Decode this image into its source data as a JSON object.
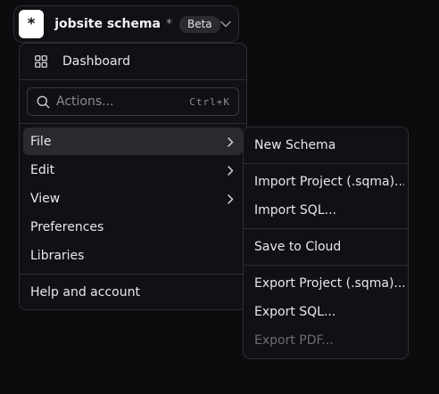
{
  "header": {
    "logo_glyph": "*",
    "project_name": "jobsite schema",
    "unsaved_marker": "*",
    "badge": "Beta"
  },
  "menu": {
    "dashboard_label": "Dashboard",
    "search": {
      "placeholder": "Actions...",
      "shortcut": "Ctrl+K"
    },
    "items": [
      {
        "label": "File",
        "has_submenu": true,
        "active": true
      },
      {
        "label": "Edit",
        "has_submenu": true
      },
      {
        "label": "View",
        "has_submenu": true
      },
      {
        "label": "Preferences"
      },
      {
        "label": "Libraries"
      }
    ],
    "help_label": "Help and account"
  },
  "file_submenu": {
    "items": [
      {
        "label": "New Schema"
      },
      {
        "label": "Import Project (.sqma)..."
      },
      {
        "label": "Import SQL..."
      },
      {
        "label": "Save to Cloud"
      },
      {
        "label": "Export Project (.sqma)..."
      },
      {
        "label": "Export SQL..."
      },
      {
        "label": "Export PDF...",
        "disabled": true
      }
    ]
  },
  "colors": {
    "background": "#0c0b0e",
    "panel": "#111014",
    "border": "#2e2d33",
    "active_row": "#2a292f",
    "disabled_text": "#6d6c72"
  }
}
